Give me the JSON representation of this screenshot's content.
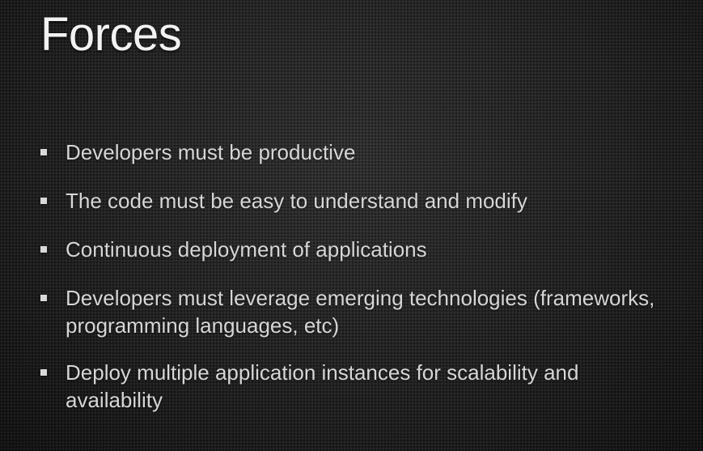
{
  "slide": {
    "title": "Forces",
    "bullets": [
      {
        "text": "Developers must be productive"
      },
      {
        "text": "The code must be easy to understand and modify"
      },
      {
        "text": "Continuous deployment of applications"
      },
      {
        "text": "Developers must leverage emerging technologies (frameworks, programming languages, etc)"
      },
      {
        "text": "Deploy multiple application instances for scalability and availability"
      }
    ]
  },
  "colors": {
    "background": "#222222",
    "title_text": "#f2f2f2",
    "body_text": "#d6d6d6",
    "bullet_marker": "#d9d9d9"
  }
}
